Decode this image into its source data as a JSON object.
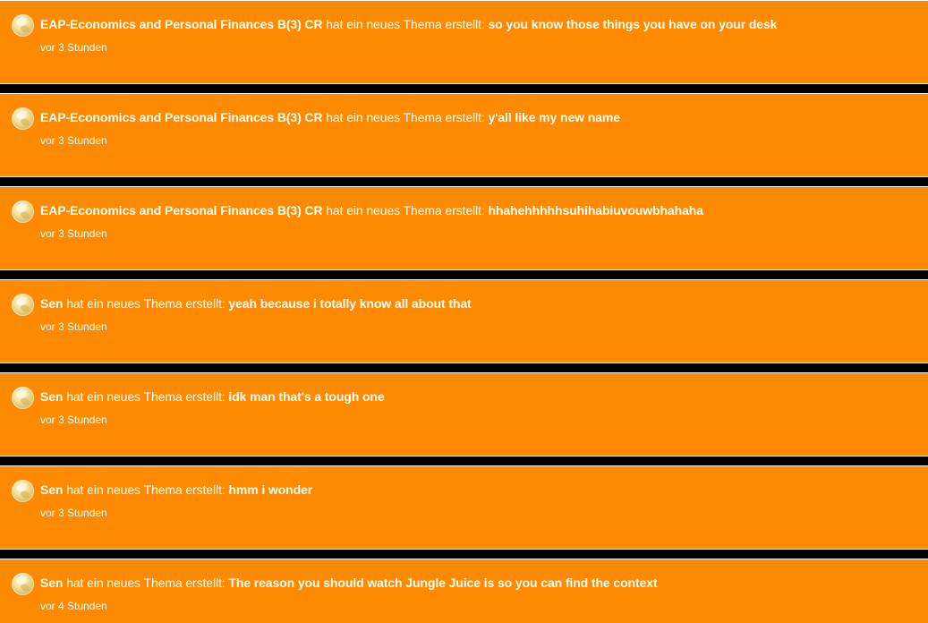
{
  "feed": {
    "items": [
      {
        "author": "EAP-Economics and Personal Finances B(3) CR",
        "action": "hat ein neues Thema erstellt:",
        "title": "so you know those things you have on your desk",
        "time": "vor 3 Stunden"
      },
      {
        "author": "EAP-Economics and Personal Finances B(3) CR",
        "action": "hat ein neues Thema erstellt:",
        "title": "y'all like my new name",
        "time": "vor 3 Stunden"
      },
      {
        "author": "EAP-Economics and Personal Finances B(3) CR",
        "action": "hat ein neues Thema erstellt:",
        "title": "hhahehhhhhsuhihabiuvouwbhahaha",
        "time": "vor 3 Stunden"
      },
      {
        "author": "Sen",
        "action": "hat ein neues Thema erstellt:",
        "title": "yeah because i totally know all about that",
        "time": "vor 3 Stunden"
      },
      {
        "author": "Sen",
        "action": "hat ein neues Thema erstellt:",
        "title": "idk man that's a tough one",
        "time": "vor 3 Stunden"
      },
      {
        "author": "Sen",
        "action": "hat ein neues Thema erstellt:",
        "title": "hmm i wonder",
        "time": "vor 3 Stunden"
      },
      {
        "author": "Sen",
        "action": "hat ein neues Thema erstellt:",
        "title": "The reason you should watch Jungle Juice is so you can find the context",
        "time": "vor 4 Stunden"
      }
    ]
  },
  "colors": {
    "item_background": "#ff8a00",
    "separator": "#000000",
    "text": "#ffffff"
  },
  "icons": {
    "avatar": "user-avatar-icon"
  }
}
